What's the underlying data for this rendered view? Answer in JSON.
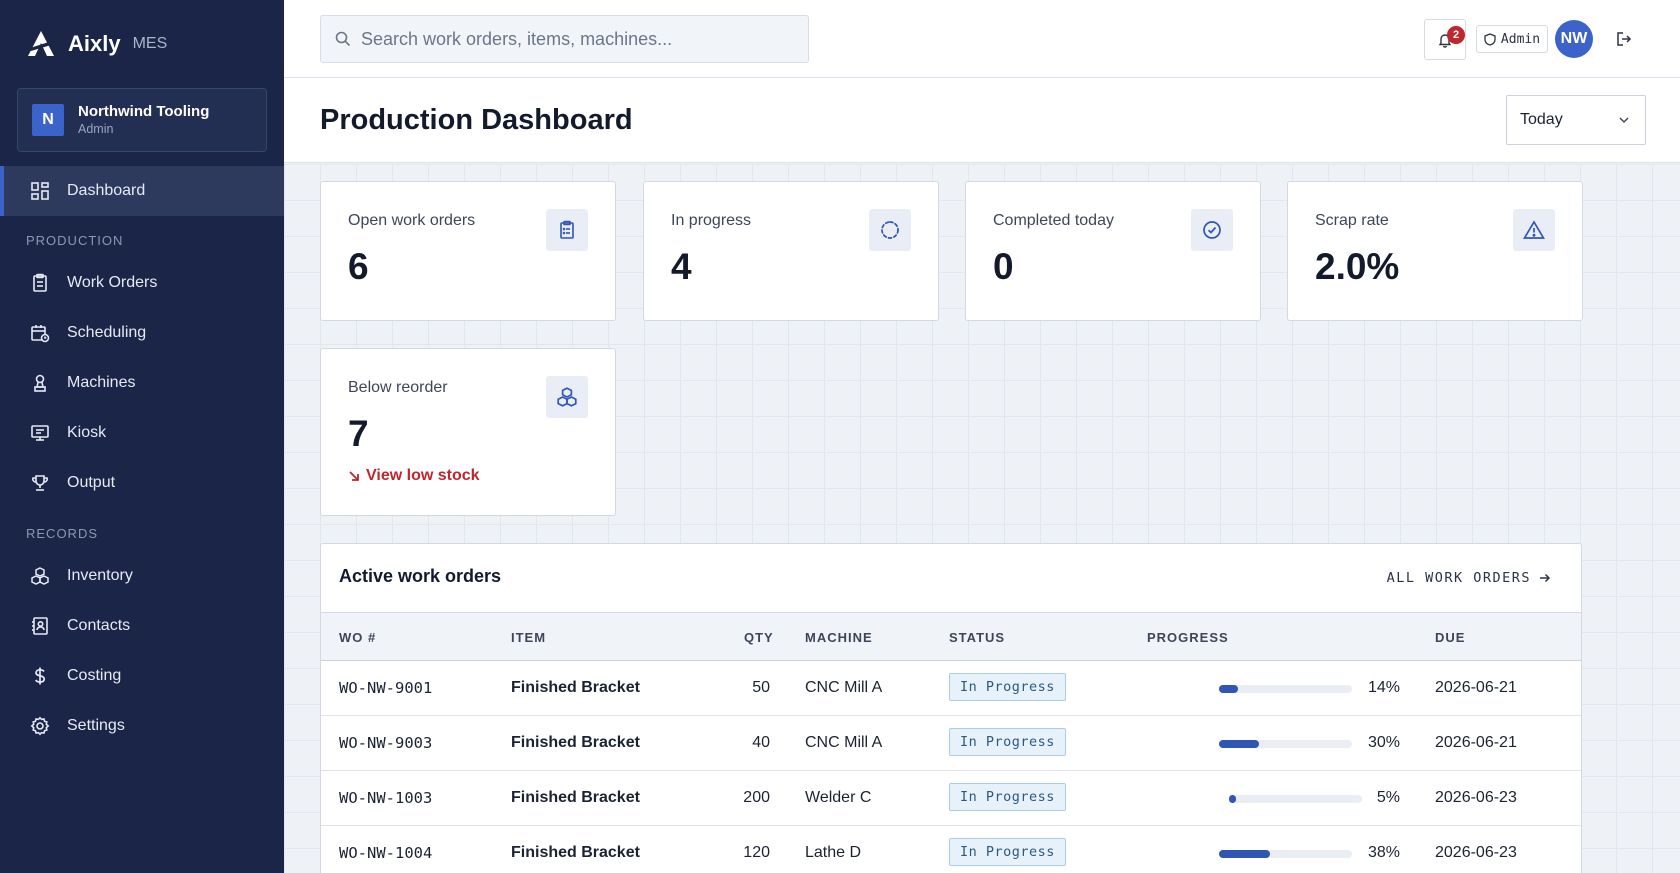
{
  "brand": {
    "name": "Aixly",
    "tag": "MES"
  },
  "org": {
    "initial": "N",
    "name": "Northwind Tooling",
    "role": "Admin"
  },
  "nav": {
    "dashboard": "Dashboard",
    "production_section": "PRODUCTION",
    "work_orders": "Work Orders",
    "scheduling": "Scheduling",
    "machines": "Machines",
    "kiosk": "Kiosk",
    "output": "Output",
    "records_section": "RECORDS",
    "inventory": "Inventory",
    "contacts": "Contacts",
    "costing": "Costing",
    "settings": "Settings"
  },
  "topbar": {
    "search_placeholder": "Search work orders, items, machines...",
    "notification_count": "2",
    "role": "Admin",
    "avatar_initials": "NW"
  },
  "page": {
    "title": "Production Dashboard",
    "range": "Today"
  },
  "kpis": {
    "open": {
      "label": "Open work orders",
      "value": "6"
    },
    "in_progress": {
      "label": "In progress",
      "value": "4"
    },
    "completed": {
      "label": "Completed today",
      "value": "0"
    },
    "scrap": {
      "label": "Scrap rate",
      "value": "2.0%"
    },
    "reorder": {
      "label": "Below reorder",
      "value": "7",
      "link": "View low stock"
    }
  },
  "colors": {
    "sidebar": "#1a2547",
    "accent": "#3b63c9",
    "danger": "#c0262d",
    "progress": "#2f55b5"
  },
  "table": {
    "title": "Active work orders",
    "link": "ALL WORK ORDERS",
    "headers": {
      "wo": "WO #",
      "item": "ITEM",
      "qty": "QTY",
      "machine": "MACHINE",
      "status": "STATUS",
      "progress": "PROGRESS",
      "due": "DUE"
    },
    "rows": [
      {
        "wo": "WO-NW-9001",
        "item": "Finished Bracket",
        "qty": "50",
        "machine": "CNC Mill A",
        "status": "In Progress",
        "progress": 14,
        "progress_label": "14%",
        "due": "2026-06-21"
      },
      {
        "wo": "WO-NW-9003",
        "item": "Finished Bracket",
        "qty": "40",
        "machine": "CNC Mill A",
        "status": "In Progress",
        "progress": 30,
        "progress_label": "30%",
        "due": "2026-06-21"
      },
      {
        "wo": "WO-NW-1003",
        "item": "Finished Bracket",
        "qty": "200",
        "machine": "Welder C",
        "status": "In Progress",
        "progress": 5,
        "progress_label": "5%",
        "due": "2026-06-23"
      },
      {
        "wo": "WO-NW-1004",
        "item": "Finished Bracket",
        "qty": "120",
        "machine": "Lathe D",
        "status": "In Progress",
        "progress": 38,
        "progress_label": "38%",
        "due": "2026-06-23"
      }
    ]
  }
}
